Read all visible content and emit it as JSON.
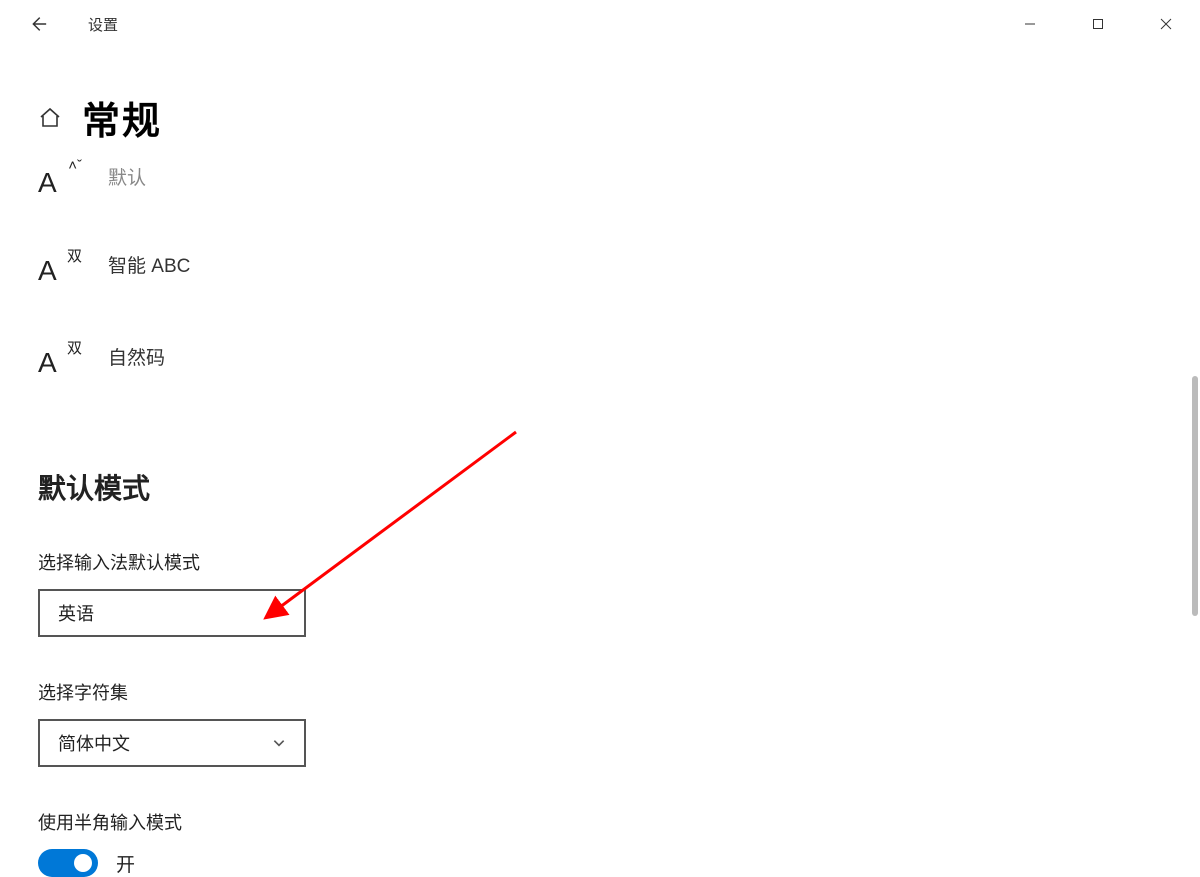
{
  "app_title": "设置",
  "page_title": "常规",
  "options": [
    {
      "icon_sup": "˄ˇ",
      "label": "默认",
      "dim": true
    },
    {
      "icon_sup": "双",
      "label": "智能 ABC",
      "dim": false
    },
    {
      "icon_sup": "双",
      "label": "自然码",
      "dim": false
    }
  ],
  "section1": {
    "title": "默认模式",
    "field1_label": "选择输入法默认模式",
    "field1_value": "英语",
    "field2_label": "选择字符集",
    "field2_value": "简体中文",
    "field3_label": "使用半角输入模式",
    "toggle_label": "开"
  },
  "colors": {
    "accent": "#0078d7",
    "annotation": "#ff0000"
  }
}
